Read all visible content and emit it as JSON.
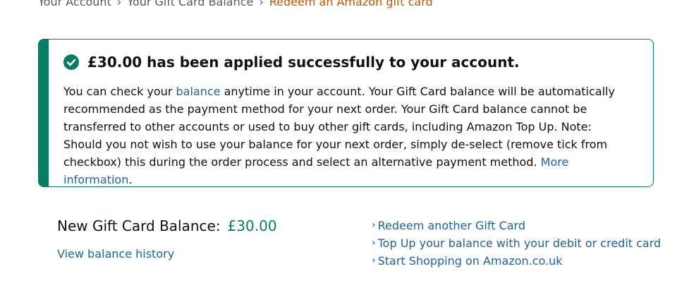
{
  "breadcrumb": {
    "items": [
      "Your Account",
      "Your Gift Card Balance"
    ],
    "separator": "›",
    "current": "Redeem an Amazon gift card"
  },
  "alert": {
    "heading": "£30.00 has been applied successfully to your account.",
    "body_part1": "You can check your ",
    "balance_link": "balance",
    "body_part2": " anytime in your account. Your Gift Card balance will be automatically recommended as the payment method for your next order. Your Gift Card balance cannot be transferred to other accounts or used to buy other gift cards, including Amazon Top Up. Note: Should you not wish to use your balance for your next order, simply de-select (remove tick from checkbox) this during the order process and select an alternative payment method. ",
    "more_info_link": "More information",
    "body_end": "."
  },
  "balance": {
    "label": "New Gift Card Balance:",
    "amount": "£30.00",
    "history_link": "View balance history"
  },
  "links": {
    "chevron": "›",
    "items": [
      "Redeem another Gift Card",
      "Top Up your balance with your debit or credit card",
      "Start Shopping on Amazon.co.uk"
    ]
  },
  "colors": {
    "success": "#067d62",
    "link": "#2162a1",
    "breadcrumb_current": "#c45500"
  },
  "icons": {
    "alert": "check-circle-icon"
  }
}
